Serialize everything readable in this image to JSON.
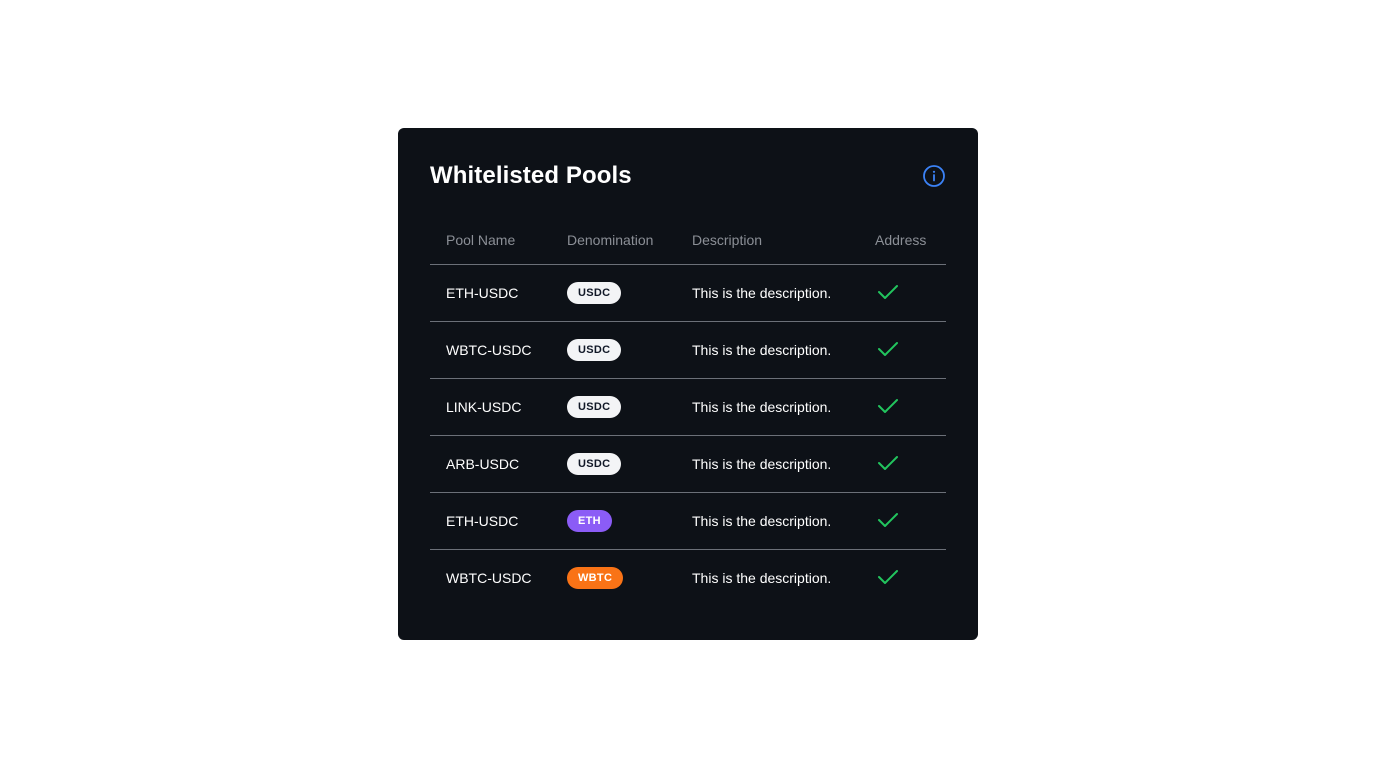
{
  "card": {
    "title": "Whitelisted Pools",
    "info_icon": "info-circle-icon",
    "accent_color": "#3b82f6"
  },
  "table": {
    "headers": [
      "Pool Name",
      "Denomination",
      "Description",
      "Address"
    ],
    "rows": [
      {
        "pool_name": "ETH-USDC",
        "denomination": "USDC",
        "description": "This is the description.",
        "address_icon": "check-icon"
      },
      {
        "pool_name": "WBTC-USDC",
        "denomination": "USDC",
        "description": "This is the description.",
        "address_icon": "check-icon"
      },
      {
        "pool_name": "LINK-USDC",
        "denomination": "USDC",
        "description": "This is the description.",
        "address_icon": "check-icon"
      },
      {
        "pool_name": "ARB-USDC",
        "denomination": "USDC",
        "description": "This is the description.",
        "address_icon": "check-icon"
      },
      {
        "pool_name": "ETH-USDC",
        "denomination": "ETH",
        "description": "This is the description.",
        "address_icon": "check-icon"
      },
      {
        "pool_name": "WBTC-USDC",
        "denomination": "WBTC",
        "description": "This is the description.",
        "address_icon": "check-icon"
      }
    ]
  },
  "badge_colors": {
    "USDC": {
      "bg": "#f3f4f6",
      "fg": "#111827"
    },
    "ETH": {
      "bg": "#8b5cf6",
      "fg": "#ffffff"
    },
    "WBTC": {
      "bg": "#f97316",
      "fg": "#ffffff"
    }
  },
  "check_color": "#22c55e"
}
